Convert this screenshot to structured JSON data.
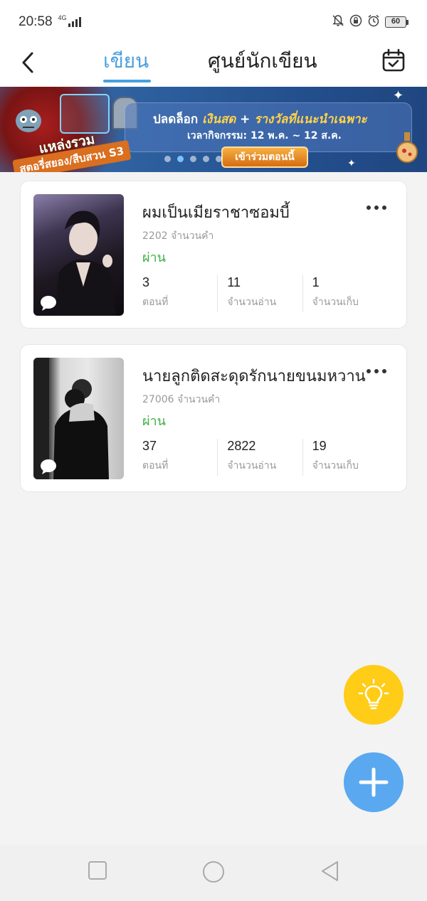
{
  "status_bar": {
    "time": "20:58",
    "network": "4G",
    "battery": "60",
    "icons": [
      "bell-off-icon",
      "lock-icon",
      "alarm-icon",
      "signal-icon",
      "battery-icon"
    ]
  },
  "header": {
    "tab_write": "เขียน",
    "tab_writer_center": "ศูนย์นักเขียน",
    "icons": [
      "back-arrow-icon",
      "calendar-check-icon"
    ],
    "accent_color": "#4a9fe0"
  },
  "banner": {
    "badge_line1": "แหล่งรวม",
    "badge_line2": "สตอรี่สยอง/สืบสวน S3",
    "headline_prefix": "ปลดล็อก",
    "headline_cash": "เงินสด",
    "headline_plus": "+",
    "headline_reward": "รางวัลที่แนะนำเฉพาะ",
    "period": "เวลากิจกรรม: 12 พ.ค. ~ 12 ส.ค.",
    "cta": "เข้าร่วมตอนนี้",
    "dots_total": 5,
    "dots_active_index": 1
  },
  "works": [
    {
      "title": "ผมเป็นเมียราชาซอมบี้",
      "word_count": "2202 จำนวนคำ",
      "status": "ผ่าน",
      "episodes": "3",
      "episodes_label": "ตอนที่",
      "reads": "11",
      "reads_label": "จำนวนอ่าน",
      "saves": "1",
      "saves_label": "จำนวนเก็บ"
    },
    {
      "title": "นายลูกติดสะดุดรักนายขนมหวาน",
      "word_count": "27006 จำนวนคำ",
      "status": "ผ่าน",
      "episodes": "37",
      "episodes_label": "ตอนที่",
      "reads": "2822",
      "reads_label": "จำนวนอ่าน",
      "saves": "19",
      "saves_label": "จำนวนเก็บ"
    }
  ],
  "fabs": {
    "idea_icon": "lightbulb-icon",
    "idea_color": "#ffcc17",
    "add_icon": "plus-icon",
    "add_color": "#5aa8f0"
  },
  "system_nav": [
    "recents-square-icon",
    "home-circle-icon",
    "back-triangle-icon"
  ]
}
